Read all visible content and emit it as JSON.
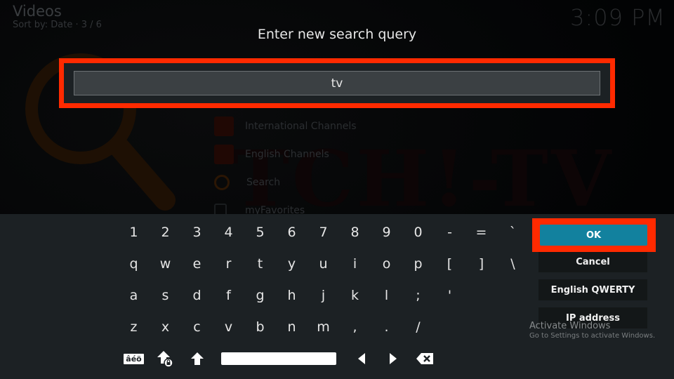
{
  "header": {
    "title": "Videos",
    "subtitle": "Sort by: Date  ·  3 / 6",
    "clock": "3:09 PM"
  },
  "background": {
    "logo_text": "TCH!-TV",
    "list": [
      {
        "label": "International Channels",
        "icon": "channel-icon"
      },
      {
        "label": "English Channels",
        "icon": "channel-icon"
      },
      {
        "label": "Search",
        "icon": "search-icon"
      },
      {
        "label": "myFavorites",
        "icon": "favorites-icon"
      }
    ]
  },
  "dialog": {
    "title": "Enter new search query",
    "input_value": "tv",
    "highlight_color": "#ff2a00"
  },
  "keyboard": {
    "rows": [
      [
        "1",
        "2",
        "3",
        "4",
        "5",
        "6",
        "7",
        "8",
        "9",
        "0",
        "-",
        "=",
        "`"
      ],
      [
        "q",
        "w",
        "e",
        "r",
        "t",
        "y",
        "u",
        "i",
        "o",
        "p",
        "[",
        "]",
        "\\"
      ],
      [
        "a",
        "s",
        "d",
        "f",
        "g",
        "h",
        "j",
        "k",
        "l",
        ";",
        "'"
      ],
      [
        "z",
        "x",
        "c",
        "v",
        "b",
        "n",
        "m",
        ",",
        ".",
        "/"
      ]
    ],
    "function_keys": {
      "symbols_label": "âéö",
      "caps_lock_icon": "caps-lock-icon",
      "shift_icon": "shift-icon",
      "space_icon": "space-bar",
      "left_icon": "arrow-left-icon",
      "right_icon": "arrow-right-icon",
      "backspace_icon": "backspace-icon"
    }
  },
  "side_buttons": {
    "ok": "OK",
    "cancel": "Cancel",
    "layout": "English QWERTY",
    "ip": "IP address",
    "ok_color": "#12819e"
  },
  "watermark": {
    "line1": "Activate Windows",
    "line2": "Go to Settings to activate Windows."
  }
}
